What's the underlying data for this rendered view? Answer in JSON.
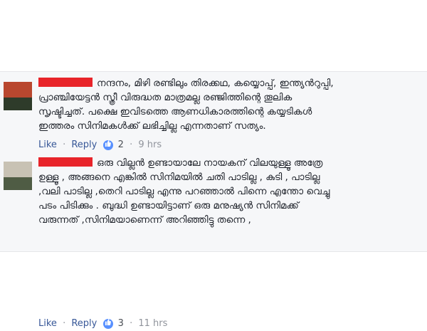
{
  "comments": [
    {
      "lines": [
        "നന്ദനം, മിഴി രണ്ടിലും തിരക്കഥ, കയ്യൊപ്പ്, ഇന്ത്യൻറുപ്പി,",
        "പ്രാഞ്ചിയേട്ടൻ സ്ത്രീ വിരുദ്ധത മാത്രമല്ല രഞ്ജിത്തിന്റെ തൂലിക",
        "സൃഷ്ടിച്ചത്. പക്ഷെ ഇവിടത്തെ ആണധികാരത്തിന്റെ കയ്യടികൾ",
        "ഇത്തരം സിനിമകൾക്ക് ലഭിച്ചില്ല എന്നതാണ് സത്യം."
      ],
      "like_label": "Like",
      "reply_label": "Reply",
      "like_count": "2",
      "time": "9 hrs",
      "sep": "·"
    },
    {
      "lines": [
        "ഒരു വില്ലൻ ഉണ്ടായാലേ നായകന് വിലയുള്ളൂ അത്രേ",
        "ഉള്ളൂ , അങ്ങനെ എങ്കിൽ സിനിമയിൽ ചതി പാടില്ല , കുടി , പാടില്ല",
        ",വലി പാടില്ല ,തെറി പാടില്ല എന്നു പറഞ്ഞാൽ പിന്നെ എന്തോ വെച്ചു",
        "പടം പിടിക്കും . ബുദ്ധി ഉണ്ടായിട്ടാണ് ഒരു മനുഷ്യൻ സിനിമക്ക്",
        "വരുന്നത് ,സിനിമയാണെന്ന് അറിഞ്ഞിട്ടു തന്നെ ,"
      ],
      "like_label": "Like",
      "reply_label": "Reply",
      "like_count": "3",
      "time": "11 hrs",
      "sep": "·"
    }
  ],
  "colors": {
    "panel_bg": "#f6f7f9",
    "link": "#385898",
    "like_badge": "#5890ff",
    "redaction": "#e8242a"
  },
  "icons": [
    "avatar",
    "like-thumb-icon",
    "redaction-bar"
  ]
}
